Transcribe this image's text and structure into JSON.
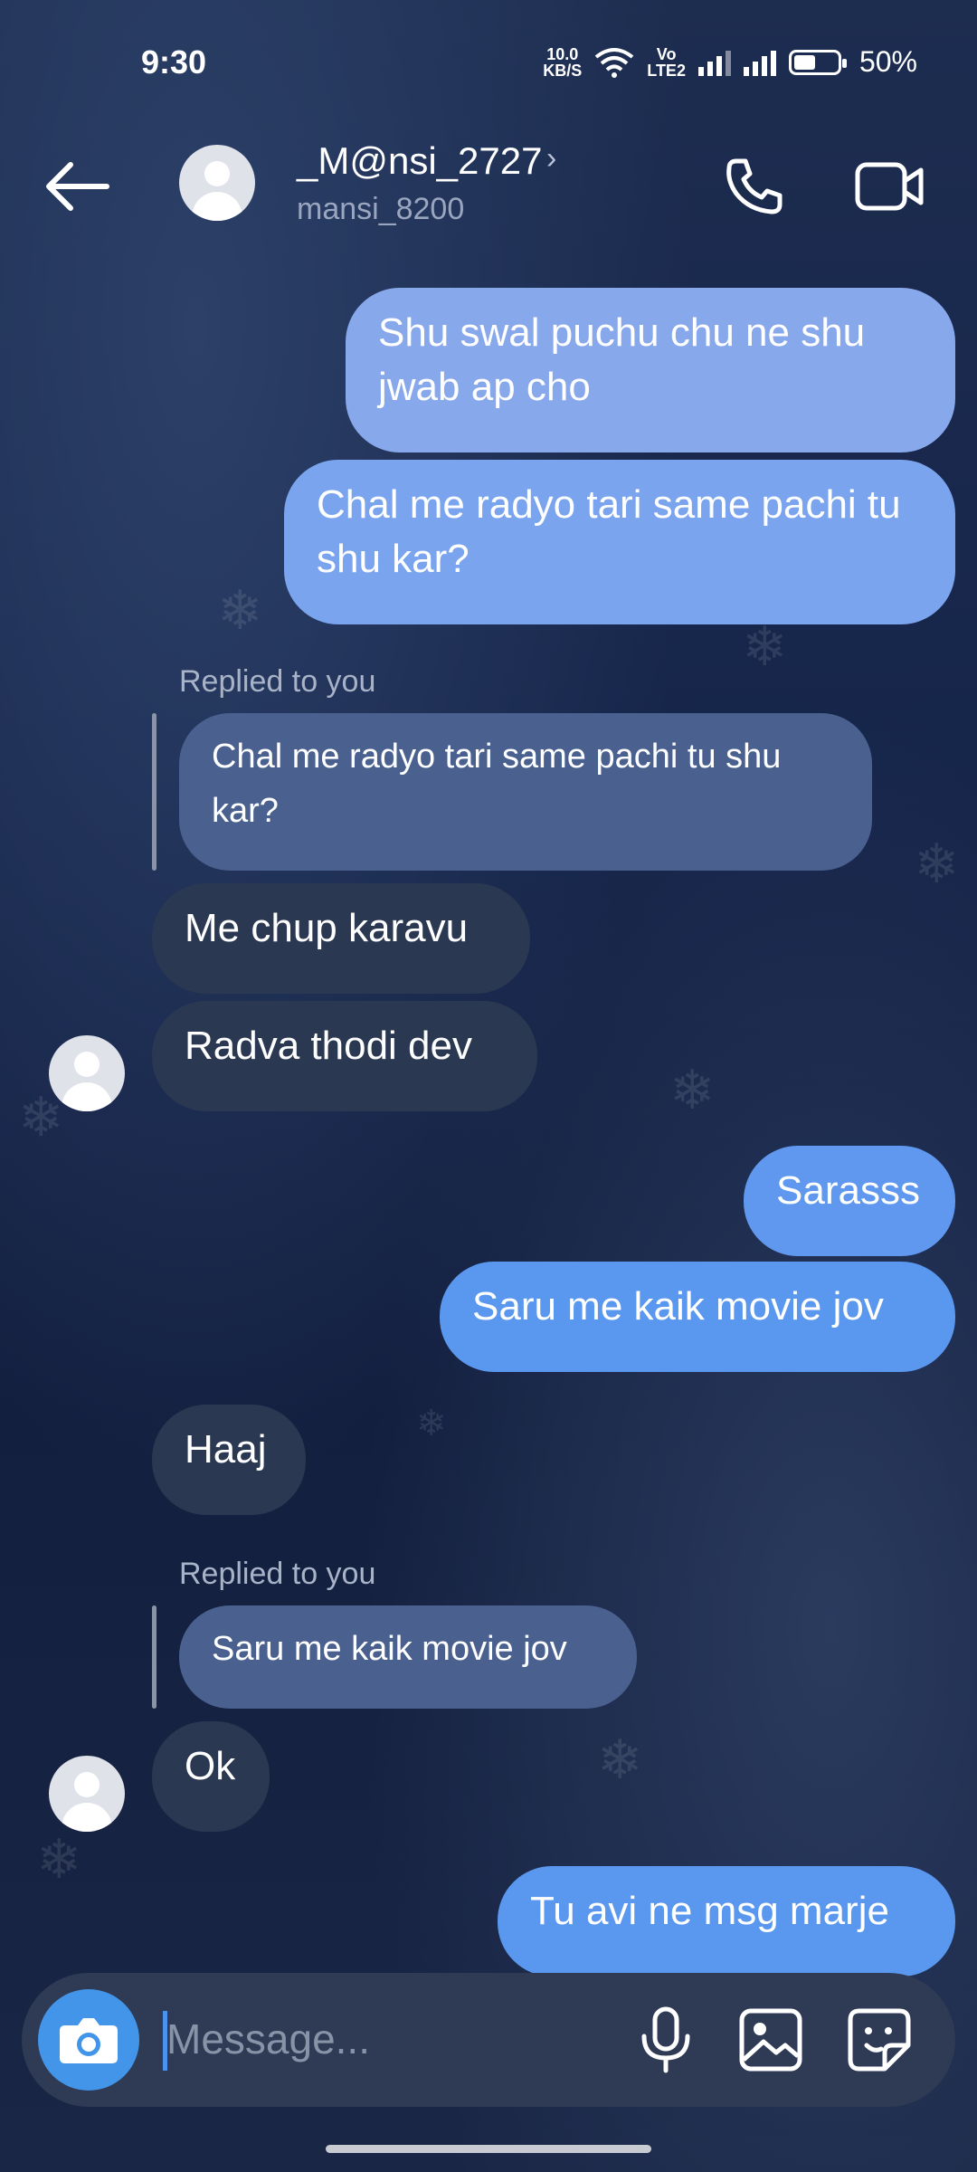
{
  "status_bar": {
    "time": "9:30",
    "speed_value": "10.0",
    "speed_unit": "KB/S",
    "volte_top": "Vo",
    "volte_bottom": "LTE2",
    "battery": "50%"
  },
  "header": {
    "name": "_M@nsi_2727",
    "chevron": "›",
    "handle": "mansi_8200"
  },
  "messages": [
    {
      "text": "Shu swal puchu chu ne shu jwab ap cho"
    },
    {
      "text": "Chal me radyo tari same pachi tu shu kar?"
    },
    {
      "label": "Replied to you",
      "quoted": "Chal me radyo tari same pachi tu shu kar?"
    },
    {
      "text": "Me chup karavu"
    },
    {
      "text": "Radva thodi dev"
    },
    {
      "text": "Sarasss"
    },
    {
      "text": "Saru me kaik movie jov"
    },
    {
      "text": "Haaj"
    },
    {
      "label": "Replied to you",
      "quoted": "Saru me kaik movie jov"
    },
    {
      "text": "Ok"
    },
    {
      "text": "Tu avi ne msg marje"
    }
  ],
  "composer": {
    "placeholder": "Message..."
  },
  "icons": {
    "back": "back-arrow-icon",
    "call": "phone-icon",
    "video": "video-camera-icon",
    "camera": "camera-icon",
    "mic": "microphone-icon",
    "gallery": "image-icon",
    "sticker": "sticker-icon"
  },
  "colors": {
    "outgoing_bubble": "#6e9ae8",
    "incoming_bubble": "#2b3852",
    "reply_bubble": "#4a6190",
    "accent": "#4395ea"
  }
}
